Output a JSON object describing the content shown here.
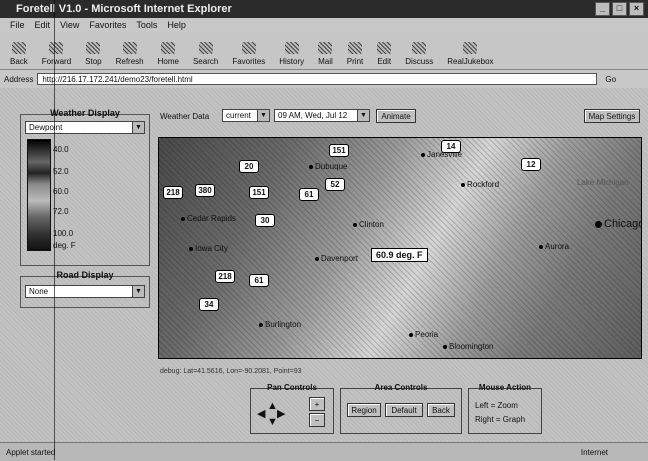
{
  "window": {
    "title": "Foretell V1.0 - Microsoft Internet Explorer",
    "controls": [
      "_",
      "□",
      "×"
    ]
  },
  "menu": [
    "File",
    "Edit",
    "View",
    "Favorites",
    "Tools",
    "Help"
  ],
  "toolbar": [
    {
      "label": "Back",
      "icon": "back-arrow-icon"
    },
    {
      "label": "Forward",
      "icon": "forward-arrow-icon"
    },
    {
      "label": "Stop",
      "icon": "stop-icon"
    },
    {
      "label": "Refresh",
      "icon": "refresh-icon"
    },
    {
      "label": "Home",
      "icon": "home-icon"
    },
    {
      "label": "Search",
      "icon": "search-icon"
    },
    {
      "label": "Favorites",
      "icon": "favorites-icon"
    },
    {
      "label": "History",
      "icon": "history-icon"
    },
    {
      "label": "Mail",
      "icon": "mail-icon"
    },
    {
      "label": "Print",
      "icon": "print-icon"
    },
    {
      "label": "Edit",
      "icon": "edit-icon"
    },
    {
      "label": "Discuss",
      "icon": "discuss-icon"
    },
    {
      "label": "RealJukebox",
      "icon": "jukebox-icon"
    }
  ],
  "address": {
    "label": "Address",
    "url": "http://216.17.172.241/demo23/foretell.html",
    "go_label": "Go"
  },
  "weather_display": {
    "title": "Weather Display",
    "selected": "Dewpoint",
    "legend": [
      "40.0",
      "52.0",
      "60.0",
      "72.0",
      "100.0",
      "deg. F"
    ]
  },
  "road_display": {
    "title": "Road Display",
    "selected": "None"
  },
  "top_controls": {
    "weather_data_label": "Weather Data",
    "data_select": "current",
    "time_select": "09 AM, Wed, Jul 12",
    "animate_label": "Animate",
    "map_settings_label": "Map Settings"
  },
  "map": {
    "tooltip": "60.9 deg. F",
    "cities": [
      {
        "name": "Dubuque",
        "big": false
      },
      {
        "name": "Janesville",
        "big": false
      },
      {
        "name": "Rockford",
        "big": false
      },
      {
        "name": "Chicago",
        "big": true
      },
      {
        "name": "Clinton",
        "big": false
      },
      {
        "name": "Cedar Rapids",
        "big": false
      },
      {
        "name": "Iowa City",
        "big": false
      },
      {
        "name": "Davenport",
        "big": false
      },
      {
        "name": "Aurora",
        "big": false
      },
      {
        "name": "Burlington",
        "big": false
      },
      {
        "name": "Peoria",
        "big": false
      },
      {
        "name": "Bloomington",
        "big": false
      },
      {
        "name": "Lake Michigan",
        "big": false
      }
    ],
    "shields": [
      "151",
      "20",
      "151",
      "61",
      "52",
      "218",
      "380",
      "30",
      "218",
      "61",
      "34",
      "14",
      "12"
    ]
  },
  "debug_text": "debug: Lat=41.5616, Lon=-90.2081, Point=93",
  "pan_controls": {
    "title": "Pan Controls",
    "up": "▲",
    "down": "▼",
    "left": "◀",
    "right": "▶",
    "zoom_in": "+",
    "zoom_out": "−"
  },
  "area_controls": {
    "title": "Area Controls",
    "region": "Region",
    "default": "Default",
    "back": "Back"
  },
  "mouse_action": {
    "title": "Mouse Action",
    "left": "Left = Zoom",
    "right": "Right = Graph"
  },
  "status": {
    "left": "Applet started",
    "right": "Internet"
  }
}
